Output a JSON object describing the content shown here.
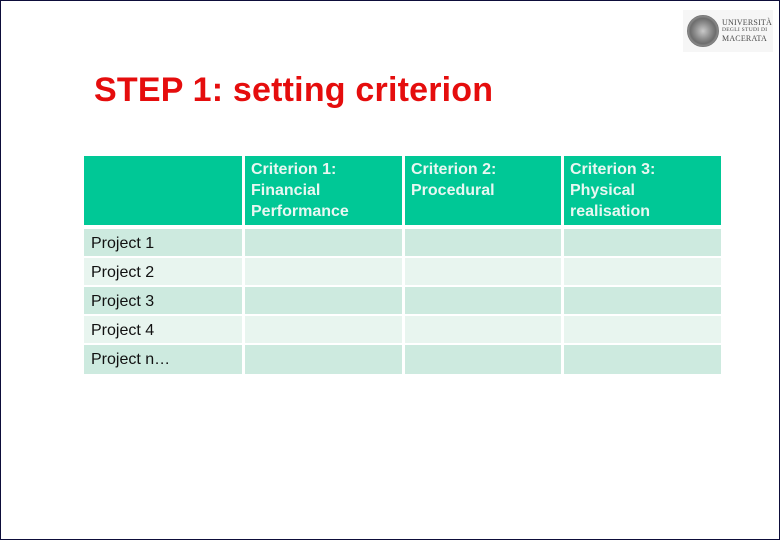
{
  "slide": {
    "title": "STEP 1: setting criterion",
    "logo": {
      "icon": "university-seal-icon",
      "line1": "UNIVERSITÀ",
      "line2": "DEGLI STUDI DI",
      "line3": "MACERATA"
    },
    "colors": {
      "title": "#e50d0d",
      "header_bg": "#00c896",
      "row_odd_bg": "#cdeadf",
      "row_even_bg": "#e8f5ef",
      "frame_border": "#0d0d3a"
    },
    "table": {
      "headers": [
        "",
        "Criterion 1: Financial Performance",
        "Criterion 2: Procedural",
        "Criterion 3: Physical realisation"
      ],
      "rows": [
        {
          "label": "Project 1",
          "cells": [
            "",
            "",
            ""
          ]
        },
        {
          "label": "Project 2",
          "cells": [
            "",
            "",
            ""
          ]
        },
        {
          "label": "Project 3",
          "cells": [
            "",
            "",
            ""
          ]
        },
        {
          "label": "Project 4",
          "cells": [
            "",
            "",
            ""
          ]
        },
        {
          "label": "Project n…",
          "cells": [
            "",
            "",
            ""
          ]
        }
      ]
    }
  }
}
